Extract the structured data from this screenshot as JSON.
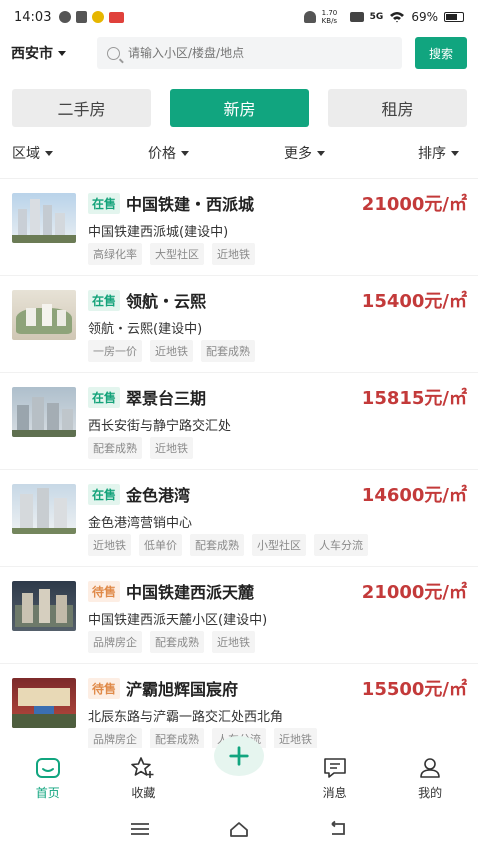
{
  "status_bar": {
    "time": "14:03",
    "net_speed": "1.70 KB/s",
    "network": "5G",
    "battery": "69%"
  },
  "search": {
    "city": "西安市",
    "placeholder": "请输入小区/楼盘/地点",
    "button": "搜索"
  },
  "type_tabs": [
    {
      "label": "二手房",
      "active": false
    },
    {
      "label": "新房",
      "active": true
    },
    {
      "label": "租房",
      "active": false
    }
  ],
  "filters": [
    "区域",
    "价格",
    "更多",
    "排序"
  ],
  "listings": [
    {
      "status": "在售",
      "name": "中国铁建・西派城",
      "price": "21000元/㎡",
      "address": "中国铁建西派城(建设中)",
      "tags": [
        "高绿化率",
        "大型社区",
        "近地铁"
      ],
      "thumb": "tall-towers"
    },
    {
      "status": "在售",
      "name": "领航・云熙",
      "price": "15400元/㎡",
      "address": "领航・云熙(建设中)",
      "tags": [
        "一房一价",
        "近地铁",
        "配套成熟"
      ],
      "thumb": "site-model"
    },
    {
      "status": "在售",
      "name": "翠景台三期",
      "price": "15815元/㎡",
      "address": "西长安街与静宁路交汇处",
      "tags": [
        "配套成熟",
        "近地铁"
      ],
      "thumb": "aerial-blocks"
    },
    {
      "status": "在售",
      "name": "金色港湾",
      "price": "14600元/㎡",
      "address": "金色港湾营销中心",
      "tags": [
        "近地铁",
        "低单价",
        "配套成熟",
        "小型社区",
        "人车分流"
      ],
      "thumb": "highrise"
    },
    {
      "status": "待售",
      "name": "中国铁建西派天麓",
      "price": "21000元/㎡",
      "address": "中国铁建西派天麓小区(建设中)",
      "tags": [
        "品牌房企",
        "配套成熟",
        "近地铁"
      ],
      "thumb": "night-aerial"
    },
    {
      "status": "待售",
      "name": "浐霸旭辉国宸府",
      "price": "15500元/㎡",
      "address": "北辰东路与浐霸一路交汇处西北角",
      "tags": [
        "品牌房企",
        "配套成熟",
        "人车分流",
        "近地铁"
      ],
      "thumb": "billboard"
    }
  ],
  "bottom_nav": [
    {
      "label": "首页",
      "icon": "home-icon",
      "active": true
    },
    {
      "label": "收藏",
      "icon": "star-add-icon",
      "active": false
    },
    {
      "label": "",
      "icon": "plus-icon",
      "active": false
    },
    {
      "label": "消息",
      "icon": "message-icon",
      "active": false
    },
    {
      "label": "我的",
      "icon": "profile-icon",
      "active": false
    }
  ],
  "colors": {
    "accent": "#11a57f",
    "price": "#c33a3a",
    "on_sale_bg": "#e3f5ee",
    "pre_sale_bg": "#fdeee4"
  }
}
